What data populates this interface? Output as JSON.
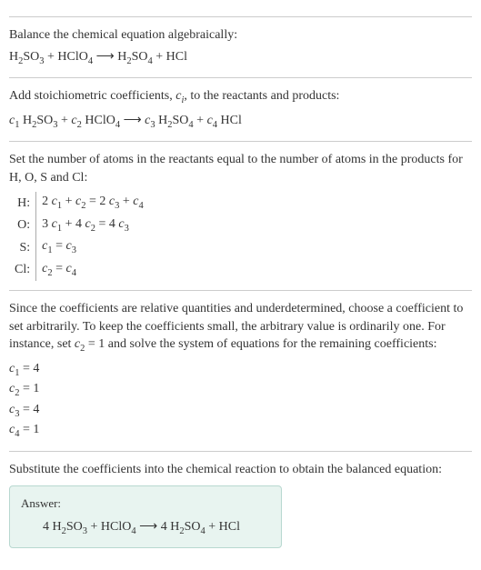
{
  "section1": {
    "title": "Balance the chemical equation algebraically:",
    "equation": "H<sub>2</sub>SO<sub>3</sub> + HClO<sub>4</sub>  ⟶  H<sub>2</sub>SO<sub>4</sub> + HCl"
  },
  "section2": {
    "title_html": "Add stoichiometric coefficients, <span class=\"italic\">c<sub>i</sub></span>, to the reactants and products:",
    "equation": "<span class=\"italic\">c</span><sub>1</sub> H<sub>2</sub>SO<sub>3</sub> + <span class=\"italic\">c</span><sub>2</sub> HClO<sub>4</sub>  ⟶  <span class=\"italic\">c</span><sub>3</sub> H<sub>2</sub>SO<sub>4</sub> + <span class=\"italic\">c</span><sub>4</sub> HCl"
  },
  "section3": {
    "title": "Set the number of atoms in the reactants equal to the number of atoms in the products for H, O, S and Cl:",
    "rows": [
      {
        "label": "H:",
        "eq": "2 <span class=\"italic\">c</span><sub>1</sub> + <span class=\"italic\">c</span><sub>2</sub> = 2 <span class=\"italic\">c</span><sub>3</sub> + <span class=\"italic\">c</span><sub>4</sub>"
      },
      {
        "label": "O:",
        "eq": "3 <span class=\"italic\">c</span><sub>1</sub> + 4 <span class=\"italic\">c</span><sub>2</sub> = 4 <span class=\"italic\">c</span><sub>3</sub>"
      },
      {
        "label": "S:",
        "eq": "<span class=\"italic\">c</span><sub>1</sub> = <span class=\"italic\">c</span><sub>3</sub>"
      },
      {
        "label": "Cl:",
        "eq": "<span class=\"italic\">c</span><sub>2</sub> = <span class=\"italic\">c</span><sub>4</sub>"
      }
    ]
  },
  "section4": {
    "title_html": "Since the coefficients are relative quantities and underdetermined, choose a coefficient to set arbitrarily. To keep the coefficients small, the arbitrary value is ordinarily one. For instance, set <span class=\"italic\">c</span><sub>2</sub> = 1 and solve the system of equations for the remaining coefficients:",
    "coefs": [
      "<span class=\"italic\">c</span><sub>1</sub> = 4",
      "<span class=\"italic\">c</span><sub>2</sub> = 1",
      "<span class=\"italic\">c</span><sub>3</sub> = 4",
      "<span class=\"italic\">c</span><sub>4</sub> = 1"
    ]
  },
  "section5": {
    "title": "Substitute the coefficients into the chemical reaction to obtain the balanced equation:",
    "answer_label": "Answer:",
    "answer_eq": "4 H<sub>2</sub>SO<sub>3</sub> + HClO<sub>4</sub>  ⟶  4 H<sub>2</sub>SO<sub>4</sub> + HCl"
  }
}
